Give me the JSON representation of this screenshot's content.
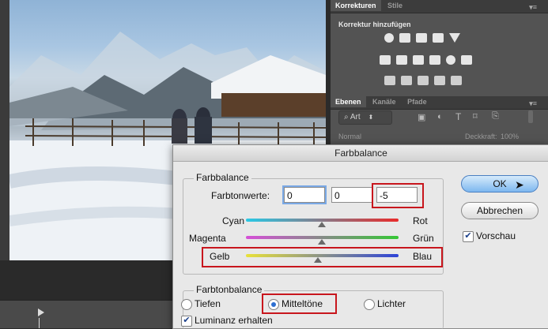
{
  "panels": {
    "adjustments_tabs": [
      "Korrekturen",
      "Stile"
    ],
    "add_adjustment_label": "Korrektur hinzufügen",
    "layers_tabs": [
      "Ebenen",
      "Kanäle",
      "Pfade"
    ],
    "filter_kind": "Art",
    "blend_mode": "Normal",
    "opacity_label": "Deckkraft:",
    "opacity_value": "100%"
  },
  "dialog": {
    "title": "Farbbalance",
    "color_balance": {
      "legend": "Farbbalance",
      "values_label": "Farbtonwerte:",
      "values": [
        "0",
        "0",
        "-5"
      ],
      "sliders": [
        {
          "left": "Cyan",
          "right": "Rot",
          "value": 0
        },
        {
          "left": "Magenta",
          "right": "Grün",
          "value": 0
        },
        {
          "left": "Gelb",
          "right": "Blau",
          "value": -5
        }
      ]
    },
    "tone_balance": {
      "legend": "Farbtonbalance",
      "options": [
        "Tiefen",
        "Mitteltöne",
        "Lichter"
      ],
      "selected": "Mitteltöne",
      "preserve_luminosity_label": "Luminanz erhalten",
      "preserve_luminosity": true
    },
    "buttons": {
      "ok": "OK",
      "cancel": "Abbrechen"
    },
    "preview_label": "Vorschau",
    "preview": true,
    "highlight_color": "#c8161d"
  }
}
